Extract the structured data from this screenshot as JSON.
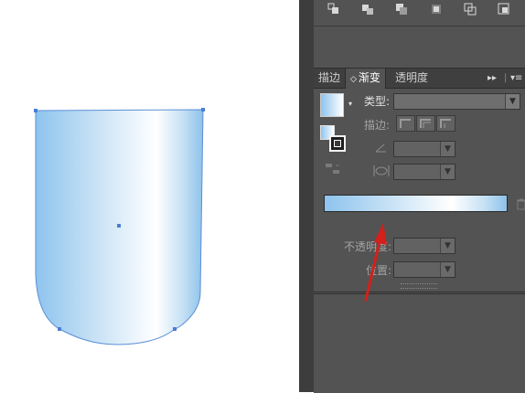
{
  "panel": {
    "tabs": [
      {
        "label": "描边",
        "active": false
      },
      {
        "label": "渐变",
        "active": true
      },
      {
        "label": "透明度",
        "active": false
      }
    ],
    "type_label": "类型:",
    "stroke_label": "描边:",
    "opacity_label": "不透明度:",
    "position_label": "位置:"
  },
  "gradient": {
    "stops": [
      "#8ec4ee",
      "#c7e1f5",
      "#ffffff",
      "#c5e0f4",
      "#8dc2ea"
    ]
  },
  "colors": {
    "panel_bg": "#535353",
    "tab_bar_bg": "#3f3f3f",
    "arrow_annotation": "#d4201b",
    "anchor_point": "#4a7fd4"
  },
  "icons": {
    "toolbar": [
      "align-icon",
      "distribute-icon",
      "arrange-front-icon",
      "arrange-back-icon",
      "pathfinder-icon",
      "expand-icon"
    ],
    "panel": [
      "gradient-swatch-icon",
      "fill-stroke-icon",
      "reverse-gradient-icon",
      "angle-icon",
      "aspect-ratio-icon",
      "delete-stop-icon"
    ]
  }
}
